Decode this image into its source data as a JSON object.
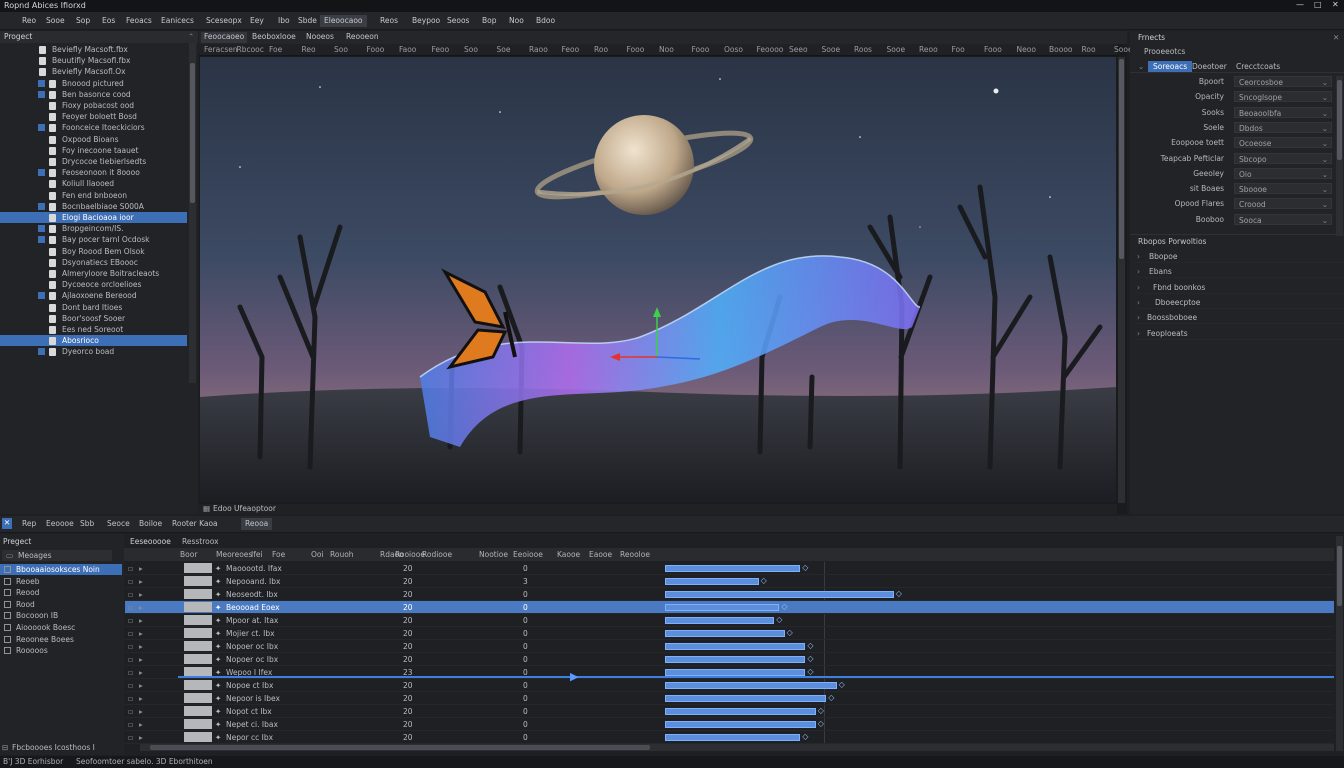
{
  "window": {
    "title": "Ropnd Abices Ifiorxd",
    "controls": [
      "—",
      "□",
      "✕"
    ]
  },
  "menu": [
    {
      "label": "Reo"
    },
    {
      "label": "Sooe"
    },
    {
      "label": "Sop"
    },
    {
      "label": "Eos"
    },
    {
      "label": "Feoacs"
    },
    {
      "label": "Eanicecs"
    },
    {
      "label": "Sceseopx"
    },
    {
      "label": "Eey"
    },
    {
      "label": "Ibo"
    },
    {
      "label": "Sbde"
    },
    {
      "label": "Eleoocaoo"
    },
    {
      "label": "Reos"
    },
    {
      "label": "Beypoo"
    },
    {
      "label": "Seoos"
    },
    {
      "label": "Bop"
    },
    {
      "label": "Noo"
    },
    {
      "label": "Bdoo"
    }
  ],
  "project_panel": {
    "title": "Progect",
    "items": [
      {
        "label": "Beviefly Macsoft.fbx"
      },
      {
        "label": "Beuutifly Macsofl.fbx"
      },
      {
        "label": "Beviefly Macsofl.Ox"
      },
      {
        "label": "Bnoood pictured"
      },
      {
        "label": "Ben basonce cood"
      },
      {
        "label": "Fioxy pobacost ood"
      },
      {
        "label": "Feoyer boloett Bosd"
      },
      {
        "label": "Foonceice Itoeckiciors"
      },
      {
        "label": "Oxpood Bioans"
      },
      {
        "label": "Foy inecoone taauet"
      },
      {
        "label": "Drycocoe tiebierlsedts"
      },
      {
        "label": "Feoseonoon it 8oooo"
      },
      {
        "label": "Koliull Ilaooed"
      },
      {
        "label": "Fen end bnboeon"
      },
      {
        "label": "Bocnbaelbiaoe S000A"
      },
      {
        "label": "Elogi Bacioaoa ioor"
      },
      {
        "label": "Bropgeincom/IS."
      },
      {
        "label": "Bay pocer tarnl Ocdosk"
      },
      {
        "label": "Boy Roood Bem Olsok"
      },
      {
        "label": "Dsyonatiecs EBoooc"
      },
      {
        "label": "Almeryloore Boitracleaots"
      },
      {
        "label": "Dycoeoce orcloelioes"
      },
      {
        "label": "Ajlaoxoene Bereood"
      },
      {
        "label": "Dont bard Itioes"
      },
      {
        "label": "Boor'soosf Sooer"
      },
      {
        "label": "Ees ned Soreoot"
      },
      {
        "label": "Abosrioco"
      },
      {
        "label": "Dyeorco boad"
      }
    ]
  },
  "viewport": {
    "tabs": [
      "Feoocaoeo",
      "Beoboxlooe",
      "Nooeos",
      "Reooeon"
    ],
    "ruler": [
      "Feracsen",
      "Rbcooc",
      "Foe",
      "Reo",
      "Soo",
      "Fooo",
      "Faoo",
      "Feoo",
      "Soo",
      "Soe",
      "Raoo",
      "Feoo",
      "Roo",
      "Fooo",
      "Noo",
      "Fooo",
      "Ooso",
      "Feoooo",
      "Seeo",
      "Sooe",
      "Roos",
      "Sooe",
      "Reoo",
      "Foo",
      "Fooo",
      "Neoo",
      "Boooo",
      "Roo",
      "Sooe",
      "Rooo w Bootoo",
      "Sooe"
    ],
    "footer_label": "Edoo Ufeaoptoor"
  },
  "effects_panel": {
    "title": "Frnects",
    "subtitle": "Prooeeotcs",
    "tabs": [
      "Soreoacs",
      "Doeotoer",
      "Crecctcoats"
    ],
    "properties": [
      {
        "label": "Bpoort",
        "value": "Ceorcosboe"
      },
      {
        "label": "Opacity",
        "value": "Sncoglsope"
      },
      {
        "label": "Sooks",
        "value": "Beoaoolbfa"
      },
      {
        "label": "Soele",
        "value": "Dbdos"
      },
      {
        "label": "Eoopooe toett",
        "value": "Ocoeose"
      },
      {
        "label": "Teapcab Pefticlar",
        "value": "Sbcopo"
      },
      {
        "label": "Geeoley",
        "value": "Oio"
      },
      {
        "label": "sit Boaes",
        "value": "Sboooe"
      },
      {
        "label": "Opood Flares",
        "value": "Croood"
      },
      {
        "label": "Booboo",
        "value": "Sooca"
      }
    ],
    "section_title": "Rbopos Porwoltios",
    "sections": [
      {
        "label": "Bbopoe"
      },
      {
        "label": "Ebans"
      },
      {
        "label": "Fbnd boonkos"
      },
      {
        "label": "Dboeecptoe"
      },
      {
        "label": "Boossboboee"
      },
      {
        "label": "Feoploeats"
      }
    ]
  },
  "bottom_tabs": [
    "Rep",
    "Eeoooe",
    "Sbb",
    "Seoce",
    "Boiloe",
    "Rooter Kaoa",
    "Reooa"
  ],
  "layers_panel": {
    "title": "Pregect",
    "header": "Meoages",
    "items": [
      "Bbooaaiosoksces Noin",
      "Reoeb",
      "Reood",
      "Rood",
      "Bocooon IB",
      "Aioooook Boesc",
      "Reoonee Boees",
      "Rooooos"
    ],
    "footer": "Fbcboooes Icosthoos I"
  },
  "timeline": {
    "title": "Eeseooooe",
    "subtitle": "Resstroox",
    "columns": [
      "Boor",
      "Meoreoes",
      "Ifei",
      "Foe",
      "Ooi",
      "Rouoh",
      "Rdaoo",
      "Rooiooe",
      "Rodiooe",
      "Nootioe",
      "Eeoiooe",
      "Kaooe",
      "Eaooe",
      "Reooloe"
    ],
    "rows": [
      {
        "label": "Maooootd. Ifax",
        "value": "20",
        "num": "0",
        "bar": 0.26
      },
      {
        "label": "Nepooand. Ibx",
        "value": "20",
        "num": "3",
        "bar": 0.18
      },
      {
        "label": "Neoseodt. Ibx",
        "value": "20",
        "num": "0",
        "bar": 0.44
      },
      {
        "label": "Beoooad Eoex",
        "value": "20",
        "num": "0",
        "bar": 0.22
      },
      {
        "label": "Mpoor at. Itax",
        "value": "20",
        "num": "0",
        "bar": 0.21
      },
      {
        "label": "Mojier ct. Ibx",
        "value": "20",
        "num": "0",
        "bar": 0.23
      },
      {
        "label": "Nopoer oc Ibx",
        "value": "20",
        "num": "0",
        "bar": 0.27
      },
      {
        "label": "Nopoer oc Ibx",
        "value": "20",
        "num": "0",
        "bar": 0.27
      },
      {
        "label": "Wepoo I Ifex",
        "value": "23",
        "num": "0",
        "bar": 0.27
      },
      {
        "label": "Nopoe ct Ibx",
        "value": "20",
        "num": "0",
        "bar": 0.33
      },
      {
        "label": "Nepoor is Ibex",
        "value": "20",
        "num": "0",
        "bar": 0.31
      },
      {
        "label": "Nopot ct Ibx",
        "value": "20",
        "num": "0",
        "bar": 0.29
      },
      {
        "label": "Nepet ci. Ibax",
        "value": "20",
        "num": "0",
        "bar": 0.29
      },
      {
        "label": "Nepor cc Ibx",
        "value": "20",
        "num": "0",
        "bar": 0.26
      }
    ]
  },
  "statusbar": {
    "left": "B'J 3D Eorhisbor",
    "right": "Seofoomtoer sabelo. 3D Eborthitoen"
  },
  "colors": {
    "accent": "#3d6fb6",
    "bar": "#5b8fdc",
    "bg": "#1e1f21"
  }
}
